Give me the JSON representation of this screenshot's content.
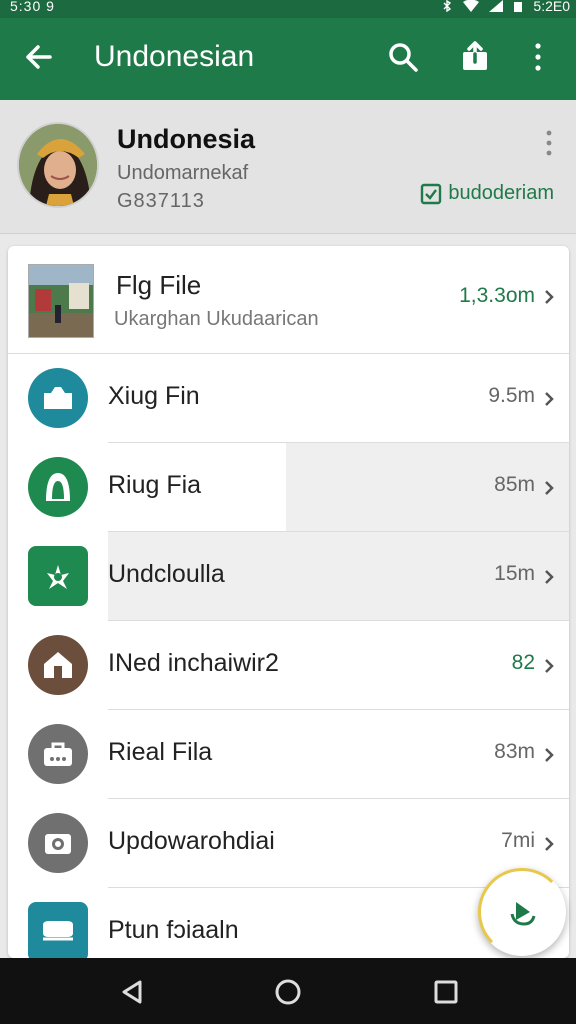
{
  "status_bar": {
    "time_left": "5:30 9",
    "time_right": "5:2E0"
  },
  "app_bar": {
    "title": "Undonesian"
  },
  "header": {
    "name": "Undonesia",
    "subtitle": "Undomarnekaf",
    "code": "G837113",
    "badge_label": "budoderiam"
  },
  "list": {
    "items": [
      {
        "title": "Flg File",
        "subtitle": "Ukarghan Ukudaarican",
        "meta": "1,3.3om",
        "meta_color": "#1f7a49",
        "icon": "photo-thumbnail"
      },
      {
        "title": "Xiug Fin",
        "meta": "9.5m",
        "icon": "briefcase-icon",
        "icon_bg": "#1e8a9c"
      },
      {
        "title": "Riug Fia",
        "meta": "85m",
        "icon": "profile-icon",
        "icon_bg": "#1f8a4f"
      },
      {
        "title": "Undcloulla",
        "meta": "15m",
        "icon": "shield-icon",
        "icon_bg": "#1f8a4f"
      },
      {
        "title": "INed inchaiwir2",
        "meta": "82",
        "meta_color": "#1f7a49",
        "icon": "home-icon",
        "icon_bg": "#6b4e3b"
      },
      {
        "title": "Rieal Fila",
        "meta": "83m",
        "icon": "bag-icon",
        "icon_bg": "#707070"
      },
      {
        "title": "Updowarohdiai",
        "meta": "7mi",
        "icon": "camera-icon",
        "icon_bg": "#707070"
      },
      {
        "title": "Ptun fɔiaaln",
        "meta": "",
        "icon": "chat-icon",
        "icon_bg": "#1e8a9c"
      }
    ]
  },
  "colors": {
    "primary": "#1f7a49",
    "primary_dark": "#1c6b40",
    "fab_ring": "#e8c84a"
  }
}
